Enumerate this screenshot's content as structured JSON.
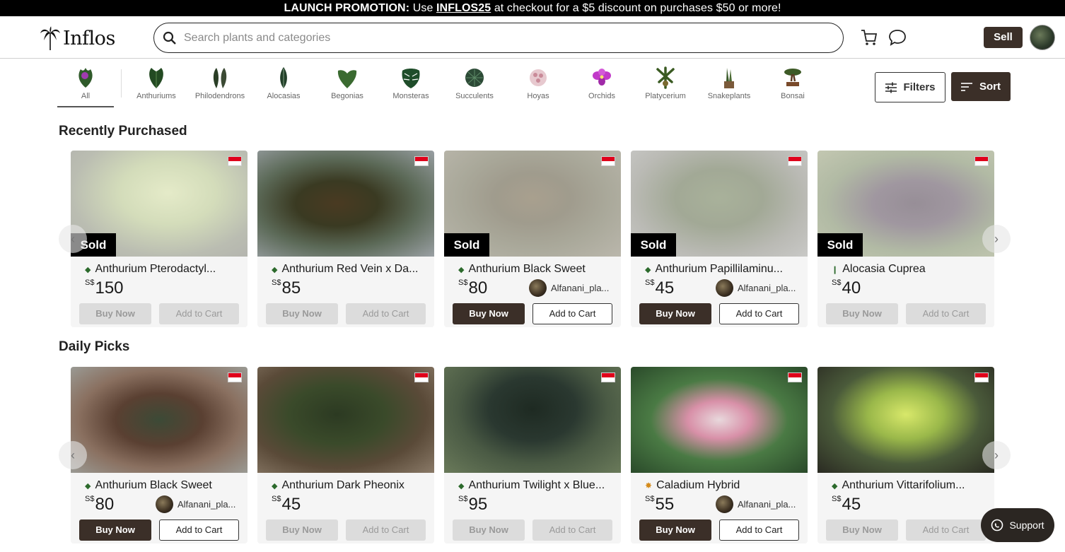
{
  "promo": {
    "prefix": "LAUNCH PROMOTION:",
    "use": "Use",
    "code": "INFLOS25",
    "suffix": "at checkout for a $5 discount on purchases $50 or more!"
  },
  "header": {
    "logo": "Inflos",
    "search_placeholder": "Search plants and categories",
    "sell_label": "Sell"
  },
  "categories": [
    {
      "label": "All",
      "icon": "all-icon",
      "active": true
    },
    {
      "label": "Anthuriums",
      "icon": "anthurium-icon"
    },
    {
      "label": "Philodendrons",
      "icon": "philodendron-icon"
    },
    {
      "label": "Alocasias",
      "icon": "alocasia-icon"
    },
    {
      "label": "Begonias",
      "icon": "begonia-icon"
    },
    {
      "label": "Monsteras",
      "icon": "monstera-icon"
    },
    {
      "label": "Succulents",
      "icon": "succulent-icon"
    },
    {
      "label": "Hoyas",
      "icon": "hoya-icon"
    },
    {
      "label": "Orchids",
      "icon": "orchid-icon"
    },
    {
      "label": "Platycerium",
      "icon": "platycerium-icon"
    },
    {
      "label": "Snakeplants",
      "icon": "snakeplant-icon"
    },
    {
      "label": "Bonsai",
      "icon": "bonsai-icon"
    }
  ],
  "toolbar": {
    "filters_label": "Filters",
    "sort_label": "Sort"
  },
  "sections": [
    {
      "title": "Recently Purchased",
      "products": [
        {
          "name": "Anthurium Pterodactyl...",
          "currency": "S$",
          "price": "150",
          "sold": "Sold",
          "seller": "",
          "buy": "Buy Now",
          "cart": "Add to Cart",
          "available": false
        },
        {
          "name": "Anthurium Red Vein x Da...",
          "currency": "S$",
          "price": "85",
          "sold": "",
          "seller": "",
          "buy": "Buy Now",
          "cart": "Add to Cart",
          "available": false
        },
        {
          "name": "Anthurium Black Sweet",
          "currency": "S$",
          "price": "80",
          "sold": "Sold",
          "seller": "Alfanani_pla...",
          "buy": "Buy Now",
          "cart": "Add to Cart",
          "available": true
        },
        {
          "name": "Anthurium Papillilaminu...",
          "currency": "S$",
          "price": "45",
          "sold": "Sold",
          "seller": "Alfanani_pla...",
          "buy": "Buy Now",
          "cart": "Add to Cart",
          "available": true
        },
        {
          "name": "Alocasia Cuprea",
          "currency": "S$",
          "price": "40",
          "sold": "Sold",
          "seller": "",
          "buy": "Buy Now",
          "cart": "Add to Cart",
          "available": false
        }
      ]
    },
    {
      "title": "Daily Picks",
      "products": [
        {
          "name": "Anthurium Black Sweet",
          "currency": "S$",
          "price": "80",
          "sold": "",
          "seller": "Alfanani_pla...",
          "buy": "Buy Now",
          "cart": "Add to Cart",
          "available": true
        },
        {
          "name": "Anthurium Dark Pheonix",
          "currency": "S$",
          "price": "45",
          "sold": "",
          "seller": "",
          "buy": "Buy Now",
          "cart": "Add to Cart",
          "available": false
        },
        {
          "name": "Anthurium Twilight x Blue...",
          "currency": "S$",
          "price": "95",
          "sold": "",
          "seller": "",
          "buy": "Buy Now",
          "cart": "Add to Cart",
          "available": false
        },
        {
          "name": "Caladium Hybrid",
          "currency": "S$",
          "price": "55",
          "sold": "",
          "seller": "Alfanani_pla...",
          "buy": "Buy Now",
          "cart": "Add to Cart",
          "available": true
        },
        {
          "name": "Anthurium Vittarifolium...",
          "currency": "S$",
          "price": "45",
          "sold": "",
          "seller": "",
          "buy": "Buy Now",
          "cart": "Add to Cart",
          "available": false
        }
      ]
    }
  ],
  "support_label": "Support",
  "colors": {
    "brand_dark": "#3b2f28",
    "promo_bg": "#000000",
    "disabled": "#dcdcdc"
  }
}
